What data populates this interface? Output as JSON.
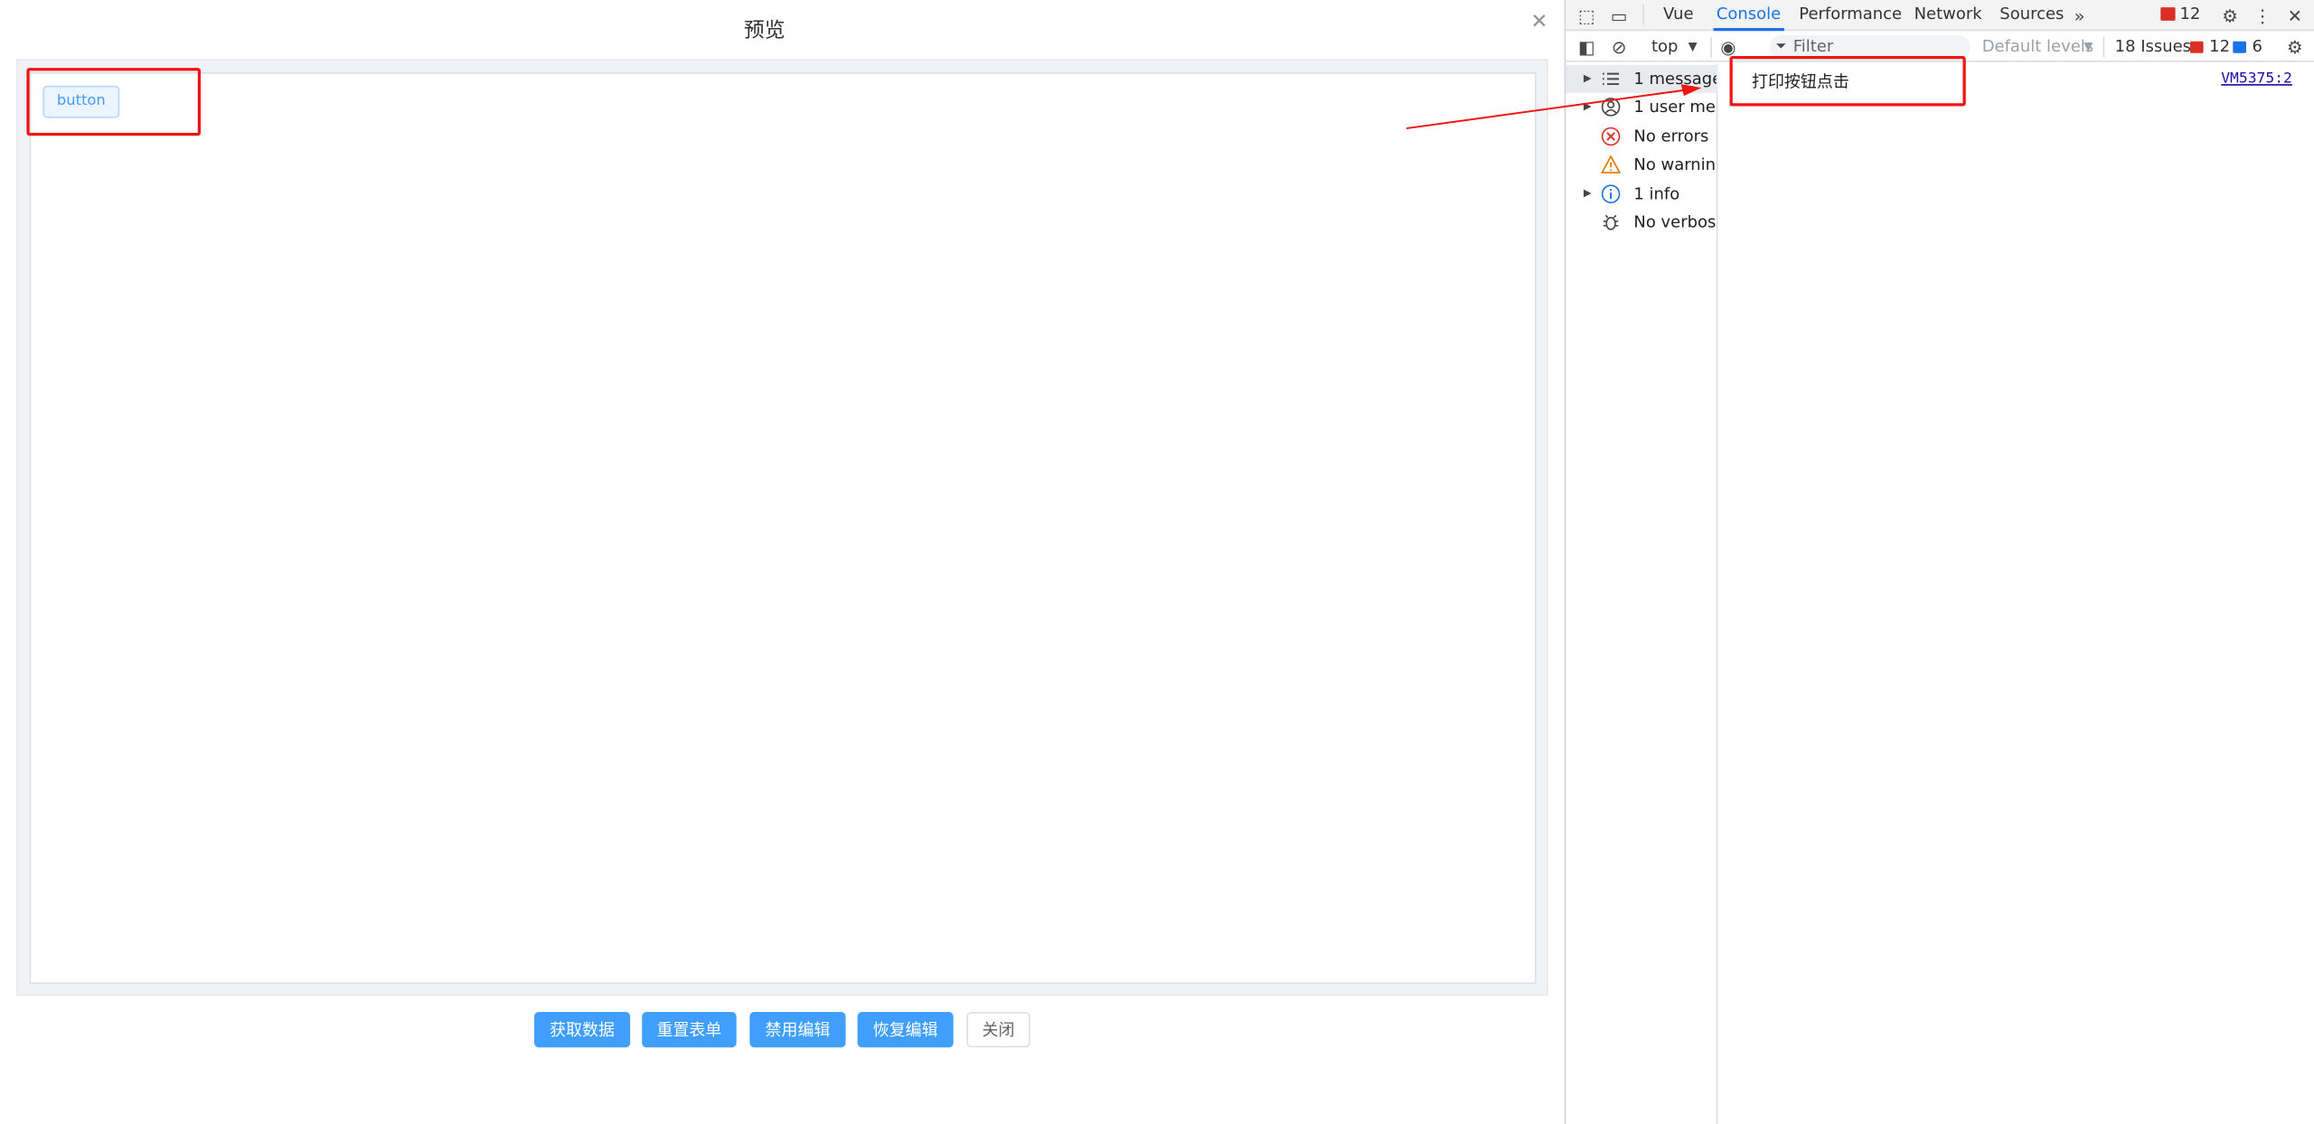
{
  "dialog": {
    "title": "预览",
    "close_icon": "close-icon",
    "demo_button_label": "button",
    "footer_buttons": [
      "获取数据",
      "重置表单",
      "禁用编辑",
      "恢复编辑",
      "关闭"
    ]
  },
  "devtools": {
    "tabs": [
      "Vue",
      "Console",
      "Performance",
      "Network",
      "Sources"
    ],
    "active_tab": "Console",
    "error_badge_count": "12",
    "context": "top",
    "filter_placeholder": "Filter",
    "levels": "Default levels",
    "issues_label": "18 Issues:",
    "issues_errors": "12",
    "issues_info": "6",
    "sidebar": [
      {
        "label": "1 message",
        "icon": "list-icon",
        "expandable": true
      },
      {
        "label": "1 user me…",
        "icon": "user-icon",
        "expandable": true
      },
      {
        "label": "No errors",
        "icon": "error-icon",
        "expandable": false
      },
      {
        "label": "No warnin…",
        "icon": "warning-icon",
        "expandable": false
      },
      {
        "label": "1 info",
        "icon": "info-icon",
        "expandable": true
      },
      {
        "label": "No verbose",
        "icon": "bug-icon",
        "expandable": false
      }
    ],
    "log": {
      "message": "打印按钮点击",
      "source": "VM5375:2"
    }
  },
  "colors": {
    "primary": "#409eff",
    "annotation": "#f01414",
    "devtools_accent": "#1a73e8"
  }
}
